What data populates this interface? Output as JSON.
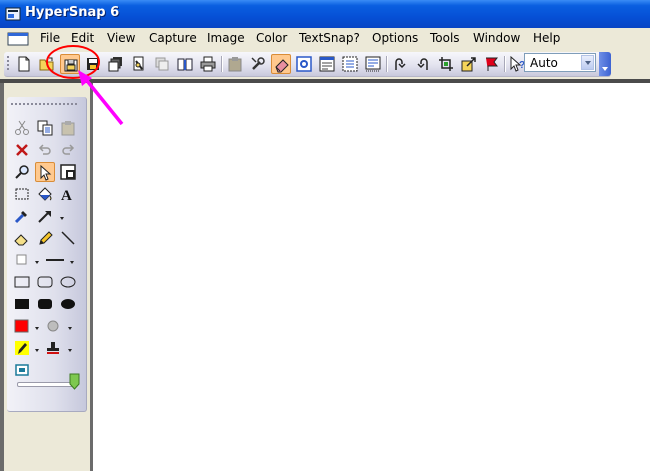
{
  "window": {
    "title": "HyperSnap 6"
  },
  "menu": {
    "items": [
      "File",
      "Edit",
      "View",
      "Capture",
      "Image",
      "Color",
      "TextSnap?",
      "Options",
      "Tools",
      "Window",
      "Help"
    ]
  },
  "toolbar": {
    "zoom_value": "Auto",
    "buttons": [
      "new-document",
      "open",
      "save-as (highlighted)",
      "save",
      "print-multiple",
      "capture-web",
      "scan",
      "book",
      "print",
      "paste-image",
      "settings",
      "eraser",
      "selection-capture",
      "capture-window",
      "capture-region",
      "capture-scrolling",
      "rotate-right",
      "rotate-left",
      "crop",
      "resize",
      "flag",
      "help"
    ]
  },
  "tools_palette": {
    "tools": [
      "cut",
      "copy",
      "paste",
      "delete",
      "undo",
      "redo",
      "zoom",
      "select",
      "frame",
      "rect-select",
      "fill",
      "text",
      "color-picker",
      "arrow",
      "eraser",
      "pencil",
      "line",
      "square-style",
      "line-style",
      "rectangle",
      "rounded-rectangle",
      "ellipse",
      "filled-rectangle",
      "filled-rounded-rectangle",
      "filled-ellipse",
      "foreground-color",
      "background-color",
      "highlighter",
      "stamp",
      "region",
      "opacity-slider"
    ]
  },
  "colors": {
    "annotation": "#ff00ff",
    "highlight_circle": "#ff0000",
    "title_bar": "#0a5fe0",
    "foreground_swatch": "#ff0000"
  }
}
